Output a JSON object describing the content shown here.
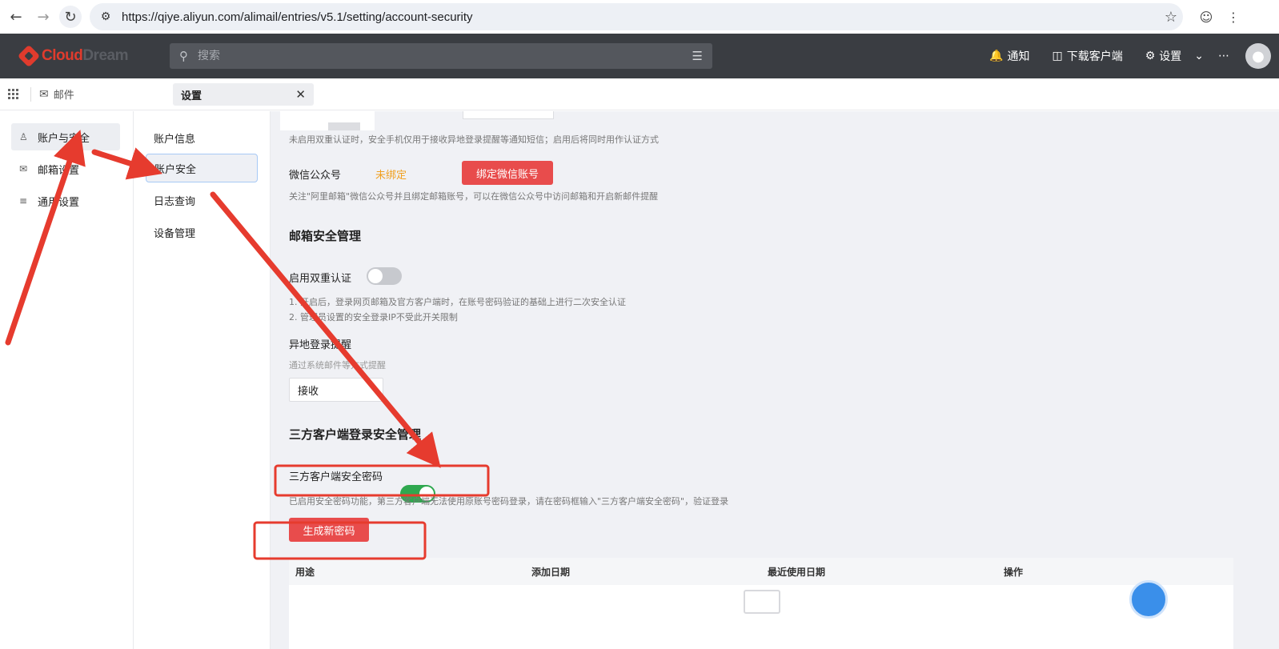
{
  "browser": {
    "url": "https://qiye.aliyun.com/alimail/entries/v5.1/setting/account-security"
  },
  "header": {
    "logo_main": "Cloud",
    "logo_accent": "Dream",
    "search_placeholder": "搜索",
    "notify_label": "通知",
    "download_label": "下载客户端",
    "settings_label": "设置"
  },
  "tabs": {
    "mail_label": "邮件",
    "settings_label": "设置"
  },
  "left_nav": {
    "items": [
      {
        "label": "账户与安全",
        "icon": "user-icon",
        "active": true
      },
      {
        "label": "邮箱设置",
        "icon": "mailbox-icon",
        "active": false
      },
      {
        "label": "通用设置",
        "icon": "sliders-icon",
        "active": false
      }
    ]
  },
  "sub_nav": {
    "items": [
      {
        "label": "账户信息",
        "active": false
      },
      {
        "label": "账户安全",
        "active": true
      },
      {
        "label": "日志查询",
        "active": false
      },
      {
        "label": "设备管理",
        "active": false
      }
    ]
  },
  "content": {
    "phone_hint": "未启用双重认证时，安全手机仅用于接收异地登录提醒等通知短信；启用后将同时用作认证方式",
    "wechat": {
      "label": "微信公众号",
      "status": "未绑定",
      "button": "绑定微信账号",
      "hint": "关注\"阿里邮箱\"微信公众号并且绑定邮箱账号，可以在微信公众号中访问邮箱和开启新邮件提醒"
    },
    "mailbox_security": {
      "title": "邮箱安全管理",
      "two_factor_label": "启用双重认证",
      "two_factor_on": false,
      "two_factor_hint_1": "1. 开启后，登录网页邮箱及官方客户端时，在账号密码验证的基础上进行二次安全认证",
      "two_factor_hint_2": "2. 管理员设置的安全登录IP不受此开关限制",
      "remote_login_label": "异地登录提醒",
      "remote_login_hint": "通过系统邮件等方式提醒",
      "remote_login_value": "接收"
    },
    "third_party": {
      "title": "三方客户端登录安全管理",
      "password_label": "三方客户端安全密码",
      "password_on": true,
      "hint": "已启用安全密码功能，第三方客户端无法使用原账号密码登录，请在密码框输入\"三方客户端安全密码\"，验证登录",
      "generate_button": "生成新密码",
      "table_headers": [
        "用途",
        "添加日期",
        "最近使用日期",
        "操作"
      ]
    }
  },
  "colors": {
    "accent_red": "#e84c4c",
    "switch_on": "#2fa84f",
    "wechat_status": "#f0a020",
    "annotation": "#e63b2e"
  }
}
